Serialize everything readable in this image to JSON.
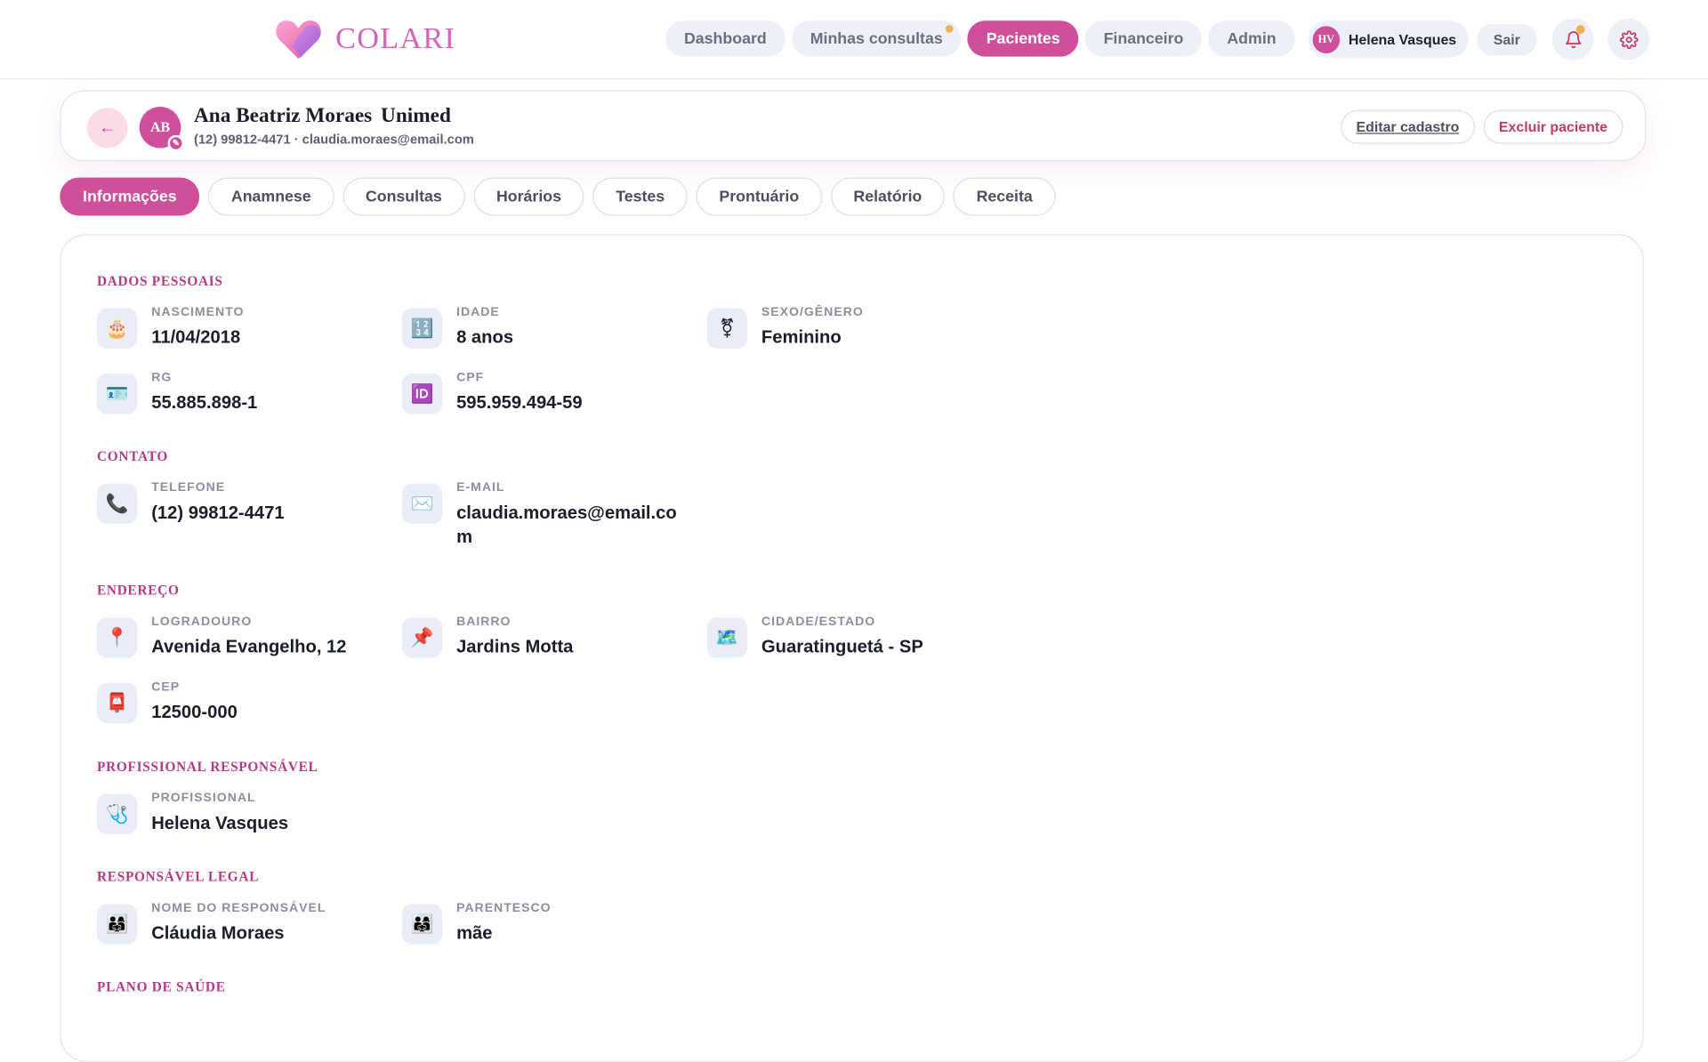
{
  "app": {
    "name": "COLARI"
  },
  "nav": [
    {
      "label": "Dashboard",
      "active": false,
      "dot": false
    },
    {
      "label": "Minhas consultas",
      "active": false,
      "dot": true
    },
    {
      "label": "Pacientes",
      "active": true,
      "dot": false
    },
    {
      "label": "Financeiro",
      "active": false,
      "dot": false
    },
    {
      "label": "Admin",
      "active": false,
      "dot": false
    }
  ],
  "user": {
    "initials": "HV",
    "name": "Helena Vasques",
    "logout_label": "Sair"
  },
  "patient": {
    "initials": "AB",
    "badge_icon": "✎",
    "name": "Ana Beatriz Moraes",
    "plan": "Unimed",
    "contact_line": "(12) 99812-4471 · claudia.moraes@email.com",
    "back_icon": "←",
    "edit_label": "Editar cadastro",
    "delete_label": "Excluir paciente"
  },
  "tabs": [
    "Informações",
    "Anamnese",
    "Consultas",
    "Horários",
    "Testes",
    "Prontuário",
    "Relatório",
    "Receita"
  ],
  "active_tab": 0,
  "sections": {
    "dados_pessoais": {
      "title": "DADOS PESSOAIS",
      "fields": [
        {
          "label": "NASCIMENTO",
          "value": "11/04/2018",
          "icon": "🎂"
        },
        {
          "label": "IDADE",
          "value": "8 anos",
          "icon": "🔢"
        },
        {
          "label": "SEXO/GÊNERO",
          "value": "Feminino",
          "icon": "⚧"
        },
        {
          "label": "RG",
          "value": "55.885.898-1",
          "icon": "🪪"
        },
        {
          "label": "CPF",
          "value": "595.959.494-59",
          "icon": "🆔"
        }
      ]
    },
    "contato": {
      "title": "CONTATO",
      "fields": [
        {
          "label": "TELEFONE",
          "value": "(12) 99812-4471",
          "icon": "📞"
        },
        {
          "label": "E-MAIL",
          "value": "claudia.moraes@email.com",
          "icon": "✉️"
        }
      ]
    },
    "endereco": {
      "title": "ENDEREÇO",
      "fields": [
        {
          "label": "LOGRADOURO",
          "value": "Avenida Evangelho, 12",
          "icon": "📍"
        },
        {
          "label": "BAIRRO",
          "value": "Jardins Motta",
          "icon": "📌"
        },
        {
          "label": "CIDADE/ESTADO",
          "value": "Guaratinguetá - SP",
          "icon": "🗺️"
        },
        {
          "label": "CEP",
          "value": "12500-000",
          "icon": "📮"
        }
      ]
    },
    "profissional": {
      "title": "PROFISSIONAL RESPONSÁVEL",
      "fields": [
        {
          "label": "PROFISSIONAL",
          "value": "Helena Vasques",
          "icon": "🩺"
        }
      ]
    },
    "responsavel": {
      "title": "RESPONSÁVEL LEGAL",
      "fields": [
        {
          "label": "NOME DO RESPONSÁVEL",
          "value": "Cláudia Moraes",
          "icon": "👨‍👩‍👧"
        },
        {
          "label": "PARENTESCO",
          "value": "mãe",
          "icon": "👨‍👩‍👧"
        }
      ]
    },
    "plano": {
      "title": "PLANO DE SAÚDE"
    }
  },
  "colors": {
    "accent": "#cf4f9b",
    "section_title": "#b23a86",
    "pill_bg": "#edf0f8"
  }
}
